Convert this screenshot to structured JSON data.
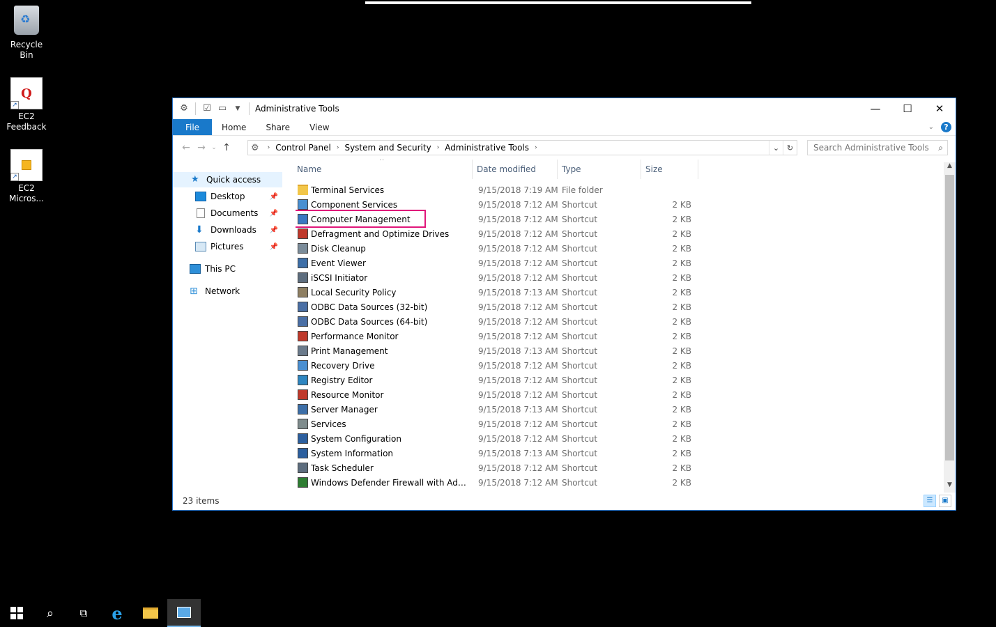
{
  "desktop": {
    "icons": [
      {
        "label": "Recycle Bin"
      },
      {
        "label": "EC2 Feedback",
        "line1": "EC2",
        "line2": "Feedback"
      },
      {
        "label": "EC2 Micros...",
        "line1": "EC2",
        "line2": "Micros..."
      }
    ]
  },
  "window": {
    "title": "Administrative Tools",
    "ribbon_tabs": [
      "File",
      "Home",
      "Share",
      "View"
    ],
    "breadcrumb": [
      "Control Panel",
      "System and Security",
      "Administrative Tools"
    ],
    "search_placeholder": "Search Administrative Tools",
    "nav": {
      "quick_access": "Quick access",
      "desktop": "Desktop",
      "documents": "Documents",
      "downloads": "Downloads",
      "pictures": "Pictures",
      "this_pc": "This PC",
      "network": "Network"
    },
    "columns": {
      "name": "Name",
      "date": "Date modified",
      "type": "Type",
      "size": "Size"
    },
    "files": [
      {
        "name": "Terminal Services",
        "date": "9/15/2018 7:19 AM",
        "type": "File folder",
        "size": ""
      },
      {
        "name": "Component Services",
        "date": "9/15/2018 7:12 AM",
        "type": "Shortcut",
        "size": "2 KB"
      },
      {
        "name": "Computer Management",
        "date": "9/15/2018 7:12 AM",
        "type": "Shortcut",
        "size": "2 KB"
      },
      {
        "name": "Defragment and Optimize Drives",
        "date": "9/15/2018 7:12 AM",
        "type": "Shortcut",
        "size": "2 KB"
      },
      {
        "name": "Disk Cleanup",
        "date": "9/15/2018 7:12 AM",
        "type": "Shortcut",
        "size": "2 KB"
      },
      {
        "name": "Event Viewer",
        "date": "9/15/2018 7:12 AM",
        "type": "Shortcut",
        "size": "2 KB"
      },
      {
        "name": "iSCSI Initiator",
        "date": "9/15/2018 7:12 AM",
        "type": "Shortcut",
        "size": "2 KB"
      },
      {
        "name": "Local Security Policy",
        "date": "9/15/2018 7:13 AM",
        "type": "Shortcut",
        "size": "2 KB"
      },
      {
        "name": "ODBC Data Sources (32-bit)",
        "date": "9/15/2018 7:12 AM",
        "type": "Shortcut",
        "size": "2 KB"
      },
      {
        "name": "ODBC Data Sources (64-bit)",
        "date": "9/15/2018 7:12 AM",
        "type": "Shortcut",
        "size": "2 KB"
      },
      {
        "name": "Performance Monitor",
        "date": "9/15/2018 7:12 AM",
        "type": "Shortcut",
        "size": "2 KB"
      },
      {
        "name": "Print Management",
        "date": "9/15/2018 7:13 AM",
        "type": "Shortcut",
        "size": "2 KB"
      },
      {
        "name": "Recovery Drive",
        "date": "9/15/2018 7:12 AM",
        "type": "Shortcut",
        "size": "2 KB"
      },
      {
        "name": "Registry Editor",
        "date": "9/15/2018 7:12 AM",
        "type": "Shortcut",
        "size": "2 KB"
      },
      {
        "name": "Resource Monitor",
        "date": "9/15/2018 7:12 AM",
        "type": "Shortcut",
        "size": "2 KB"
      },
      {
        "name": "Server Manager",
        "date": "9/15/2018 7:13 AM",
        "type": "Shortcut",
        "size": "2 KB"
      },
      {
        "name": "Services",
        "date": "9/15/2018 7:12 AM",
        "type": "Shortcut",
        "size": "2 KB"
      },
      {
        "name": "System Configuration",
        "date": "9/15/2018 7:12 AM",
        "type": "Shortcut",
        "size": "2 KB"
      },
      {
        "name": "System Information",
        "date": "9/15/2018 7:13 AM",
        "type": "Shortcut",
        "size": "2 KB"
      },
      {
        "name": "Task Scheduler",
        "date": "9/15/2018 7:12 AM",
        "type": "Shortcut",
        "size": "2 KB"
      },
      {
        "name": "Windows Defender Firewall with Advanc...",
        "date": "9/15/2018 7:12 AM",
        "type": "Shortcut",
        "size": "2 KB"
      }
    ],
    "status": "23 items"
  },
  "colors": {
    "accent": "#1979ca",
    "highlight": "#e0167a",
    "selected_nav": "#e5f3ff"
  }
}
